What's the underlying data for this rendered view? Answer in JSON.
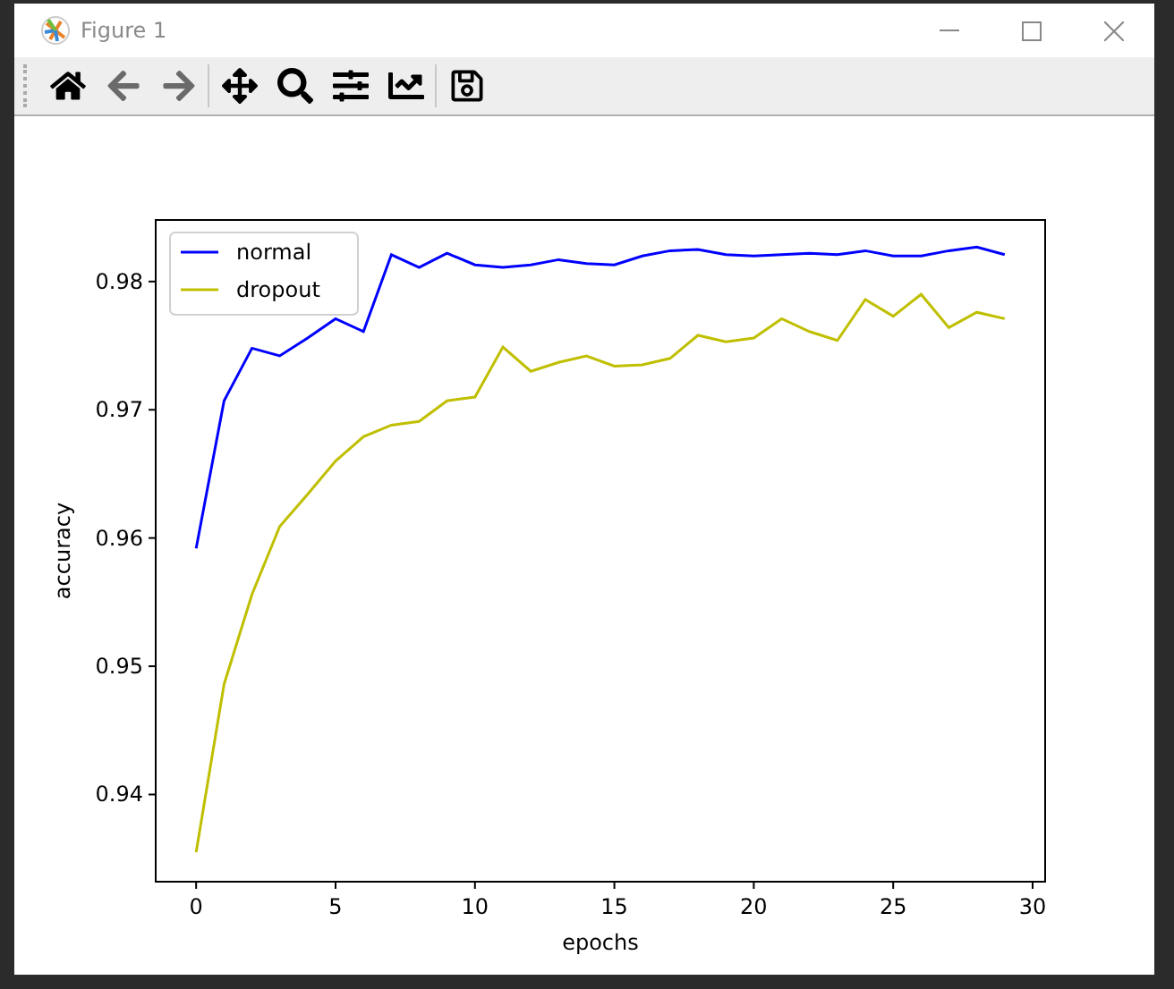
{
  "window": {
    "title": "Figure 1"
  },
  "toolbar": [
    {
      "kind": "home",
      "disabled": false
    },
    {
      "kind": "back",
      "disabled": true
    },
    {
      "kind": "forward",
      "disabled": true
    },
    {
      "kind": "pan",
      "disabled": false
    },
    {
      "kind": "zoom",
      "disabled": false
    },
    {
      "kind": "subplots",
      "disabled": false
    },
    {
      "kind": "customize",
      "disabled": false
    },
    {
      "kind": "save",
      "disabled": false
    }
  ],
  "figure": {
    "chart_data": {
      "type": "line",
      "xlabel": "epochs",
      "ylabel": "accuracy",
      "x": [
        0,
        1,
        2,
        3,
        4,
        5,
        6,
        7,
        8,
        9,
        10,
        11,
        12,
        13,
        14,
        15,
        16,
        17,
        18,
        19,
        20,
        21,
        22,
        23,
        24,
        25,
        26,
        27,
        28,
        29
      ],
      "series": [
        {
          "name": "normal",
          "color": "#0000ff",
          "values": [
            0.9592,
            0.9707,
            0.9748,
            0.9742,
            0.9756,
            0.9771,
            0.9761,
            0.9821,
            0.9811,
            0.9822,
            0.9813,
            0.9811,
            0.9813,
            0.9817,
            0.9814,
            0.9813,
            0.982,
            0.9824,
            0.9825,
            0.9821,
            0.982,
            0.9821,
            0.9822,
            0.9821,
            0.9824,
            0.982,
            0.982,
            0.9824,
            0.9827,
            0.9821
          ]
        },
        {
          "name": "dropout",
          "color": "#bfbf00",
          "values": [
            0.9355,
            0.9486,
            0.9556,
            0.9609,
            0.9634,
            0.966,
            0.9679,
            0.9688,
            0.9691,
            0.9707,
            0.971,
            0.9749,
            0.973,
            0.9737,
            0.9742,
            0.9734,
            0.9735,
            0.974,
            0.9758,
            0.9753,
            0.9756,
            0.9771,
            0.9761,
            0.9754,
            0.9786,
            0.9773,
            0.979,
            0.9764,
            0.9776,
            0.9771
          ]
        }
      ],
      "xlim": [
        -1.45,
        30.45
      ],
      "ylim": [
        0.9332,
        0.9848
      ],
      "xticks": [
        0,
        5,
        10,
        15,
        20,
        25,
        30
      ],
      "yticks": [
        0.94,
        0.95,
        0.96,
        0.97,
        0.98
      ],
      "legend": "upper left"
    }
  }
}
